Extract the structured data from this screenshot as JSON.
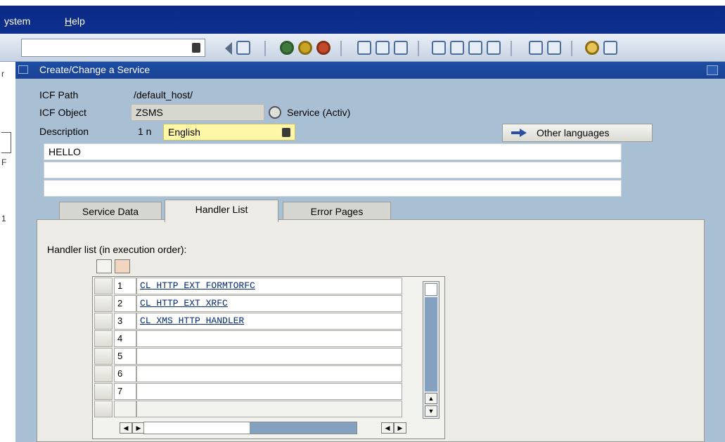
{
  "menubar": {
    "items": [
      {
        "label": "ystem",
        "mnemonic": "S"
      },
      {
        "label": "elp",
        "mnemonic": "H"
      }
    ]
  },
  "toolbar": {
    "command_field_value": "",
    "icons": [
      "back-icon",
      "save-icon",
      "enter-icon",
      "exit-icon",
      "cancel-icon",
      "print-icon",
      "find-icon",
      "find-next-icon",
      "first-page-icon",
      "prev-page-icon",
      "next-page-icon",
      "last-page-icon",
      "new-session-icon",
      "shortcut-icon",
      "help-icon",
      "settings-icon"
    ]
  },
  "window": {
    "title": "Create/Change a Service"
  },
  "form": {
    "icf_path_label": "ICF Path",
    "icf_path_value": "/default_host/",
    "icf_object_label": "ICF Object",
    "icf_object_value": "ZSMS",
    "service_status": "Service (Activ)",
    "description_label": "Description",
    "language_prefix": "1 n",
    "language_value": "English",
    "other_languages_label": "Other languages",
    "description_lines": [
      "HELLO",
      "",
      ""
    ]
  },
  "tabs": [
    {
      "label": "Service Data",
      "active": false
    },
    {
      "label": "Handler List",
      "active": true
    },
    {
      "label": "Error Pages",
      "active": false
    }
  ],
  "handler": {
    "label": "Handler list (in execution order):",
    "rows": [
      {
        "num": "1",
        "value": "CL_HTTP_EXT_FORMTORFC"
      },
      {
        "num": "2",
        "value": "CL_HTTP_EXT_XRFC"
      },
      {
        "num": "3",
        "value": "CL_XMS_HTTP_HANDLER"
      },
      {
        "num": "4",
        "value": ""
      },
      {
        "num": "5",
        "value": ""
      },
      {
        "num": "6",
        "value": ""
      },
      {
        "num": "7",
        "value": ""
      }
    ]
  },
  "colors": {
    "menubar": "#0e2f8f",
    "titlebar": "#1a4194",
    "content_bg": "#a9bfd3",
    "panel_bg": "#ecebe6",
    "language_field": "#fff6a8"
  }
}
